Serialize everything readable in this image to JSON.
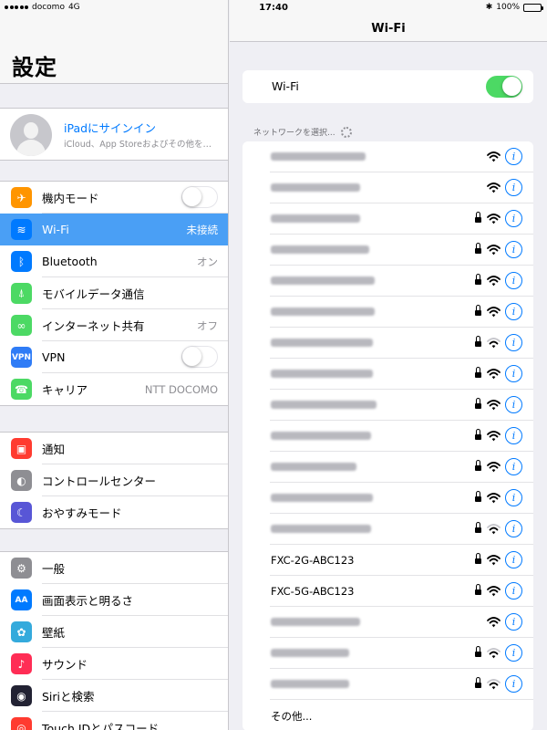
{
  "status_bar": {
    "carrier": "docomo",
    "network": "4G",
    "time": "17:40",
    "battery": "100%"
  },
  "left": {
    "title": "設定",
    "profile": {
      "title": "iPadにサインイン",
      "subtitle": "iCloud、App Storeおよびその他を…"
    },
    "groups": [
      [
        {
          "label": "機内モード",
          "icon": "airplane-icon",
          "color": "#ff9500",
          "type": "switch",
          "on": false
        },
        {
          "label": "Wi-Fi",
          "icon": "wifi-icon",
          "color": "#007aff",
          "value": "未接続",
          "selected": true
        },
        {
          "label": "Bluetooth",
          "icon": "bluetooth-icon",
          "color": "#007aff",
          "value": "オン"
        },
        {
          "label": "モバイルデータ通信",
          "icon": "antenna-icon",
          "color": "#4cd964"
        },
        {
          "label": "インターネット共有",
          "icon": "link-icon",
          "color": "#4cd964",
          "value": "オフ"
        },
        {
          "label": "VPN",
          "icon": "vpn-icon",
          "color": "#2f7cf6",
          "type": "switch",
          "on": false,
          "icon_text": "VPN"
        },
        {
          "label": "キャリア",
          "icon": "phone-icon",
          "color": "#4cd964",
          "value": "NTT DOCOMO"
        }
      ],
      [
        {
          "label": "通知",
          "icon": "notifications-icon",
          "color": "#ff3b30"
        },
        {
          "label": "コントロールセンター",
          "icon": "control-center-icon",
          "color": "#8e8e93"
        },
        {
          "label": "おやすみモード",
          "icon": "moon-icon",
          "color": "#5856d6"
        }
      ],
      [
        {
          "label": "一般",
          "icon": "gear-icon",
          "color": "#8e8e93"
        },
        {
          "label": "画面表示と明るさ",
          "icon": "display-icon",
          "color": "#007aff",
          "icon_text": "AA"
        },
        {
          "label": "壁紙",
          "icon": "wallpaper-icon",
          "color": "#34aadc"
        },
        {
          "label": "サウンド",
          "icon": "sound-icon",
          "color": "#ff2d55"
        },
        {
          "label": "Siriと検索",
          "icon": "siri-icon",
          "color": "#222233"
        },
        {
          "label": "Touch IDとパスコード",
          "icon": "fingerprint-icon",
          "color": "#ff3b30"
        }
      ]
    ]
  },
  "right": {
    "title": "Wi-Fi",
    "wifi_label": "Wi-Fi",
    "wifi_on": true,
    "networks_heading": "ネットワークを選択...",
    "networks": [
      {
        "ssid": "",
        "locked": false,
        "strength": 3
      },
      {
        "ssid": "",
        "locked": false,
        "strength": 3
      },
      {
        "ssid": "",
        "locked": true,
        "strength": 3
      },
      {
        "ssid": "",
        "locked": true,
        "strength": 3
      },
      {
        "ssid": "",
        "locked": true,
        "strength": 3
      },
      {
        "ssid": "",
        "locked": true,
        "strength": 3
      },
      {
        "ssid": "",
        "locked": true,
        "strength": 2
      },
      {
        "ssid": "",
        "locked": true,
        "strength": 3
      },
      {
        "ssid": "",
        "locked": true,
        "strength": 3
      },
      {
        "ssid": "",
        "locked": true,
        "strength": 3
      },
      {
        "ssid": "",
        "locked": true,
        "strength": 3
      },
      {
        "ssid": "",
        "locked": true,
        "strength": 3
      },
      {
        "ssid": "",
        "locked": true,
        "strength": 2
      },
      {
        "ssid": "FXC-2G-ABC123",
        "locked": true,
        "strength": 3
      },
      {
        "ssid": "FXC-5G-ABC123",
        "locked": true,
        "strength": 3
      },
      {
        "ssid": "",
        "locked": false,
        "strength": 3
      },
      {
        "ssid": "",
        "locked": true,
        "strength": 2
      },
      {
        "ssid": "",
        "locked": true,
        "strength": 2
      }
    ],
    "other_label": "その他..."
  }
}
